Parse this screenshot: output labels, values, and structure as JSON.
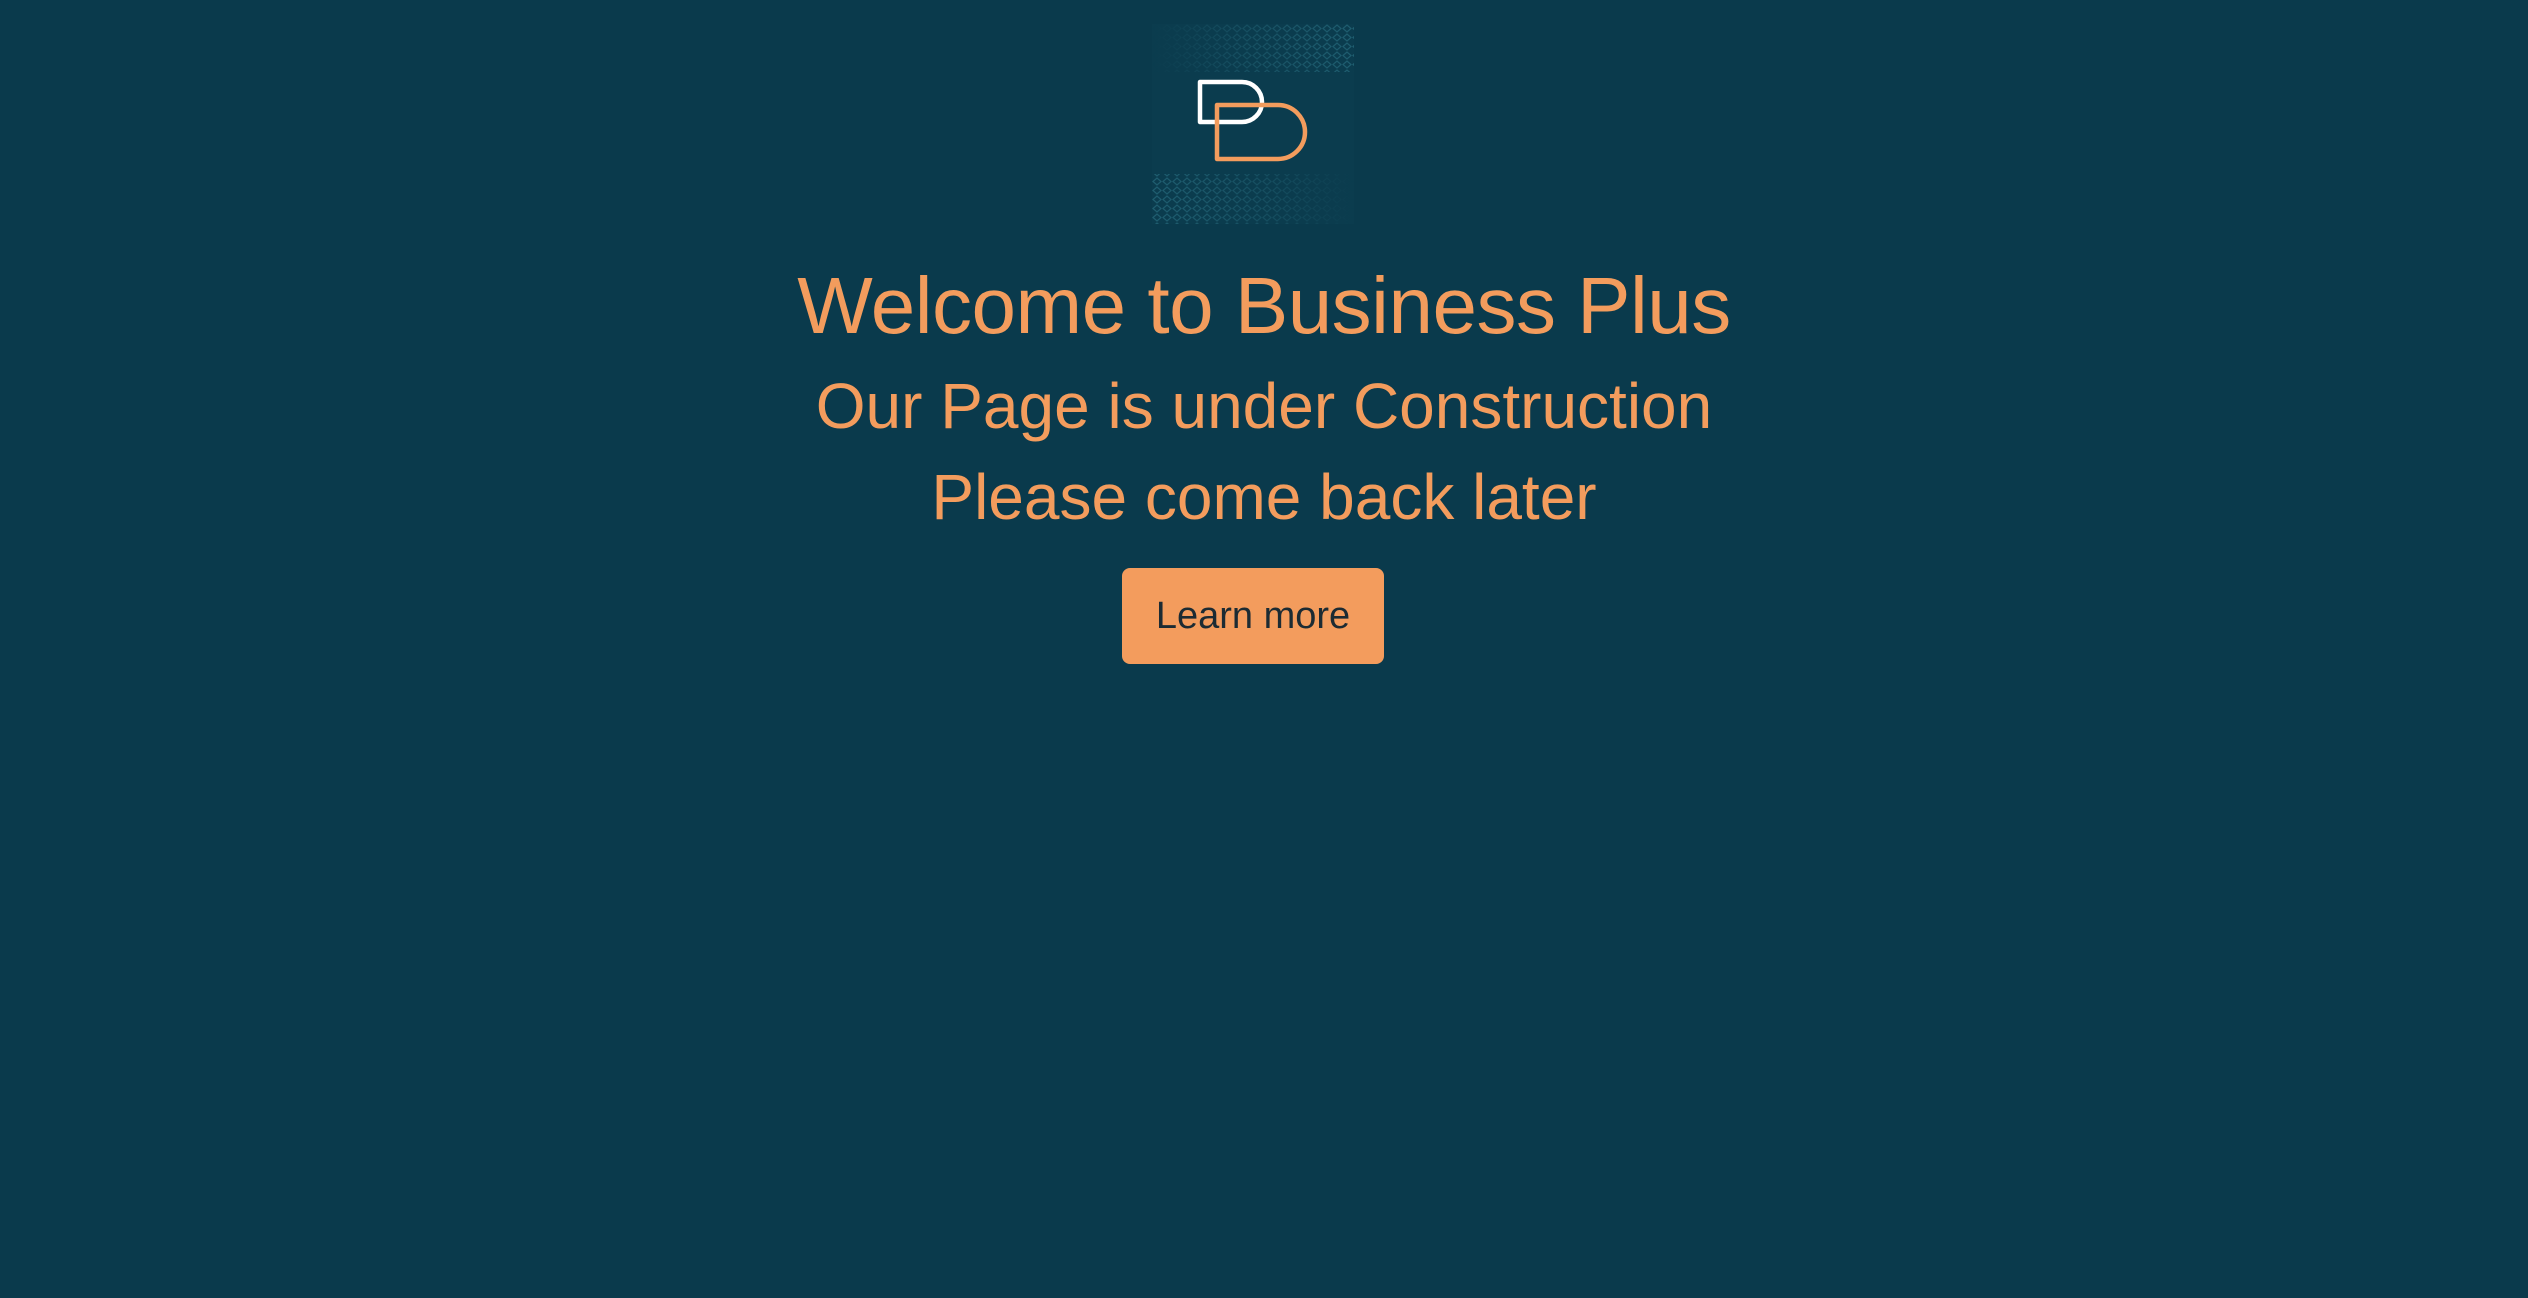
{
  "brand": {
    "logo_icon": "bp-monogram-logo",
    "colors": {
      "background": "#0a3a4c",
      "accent": "#f39c5d",
      "logo_white": "#ffffff",
      "pattern": "#1f5e70"
    }
  },
  "hero": {
    "title": "Welcome to Business Plus",
    "subtitle": "Our Page is under Construction",
    "message": "Please come back later",
    "cta_label": "Learn more"
  }
}
